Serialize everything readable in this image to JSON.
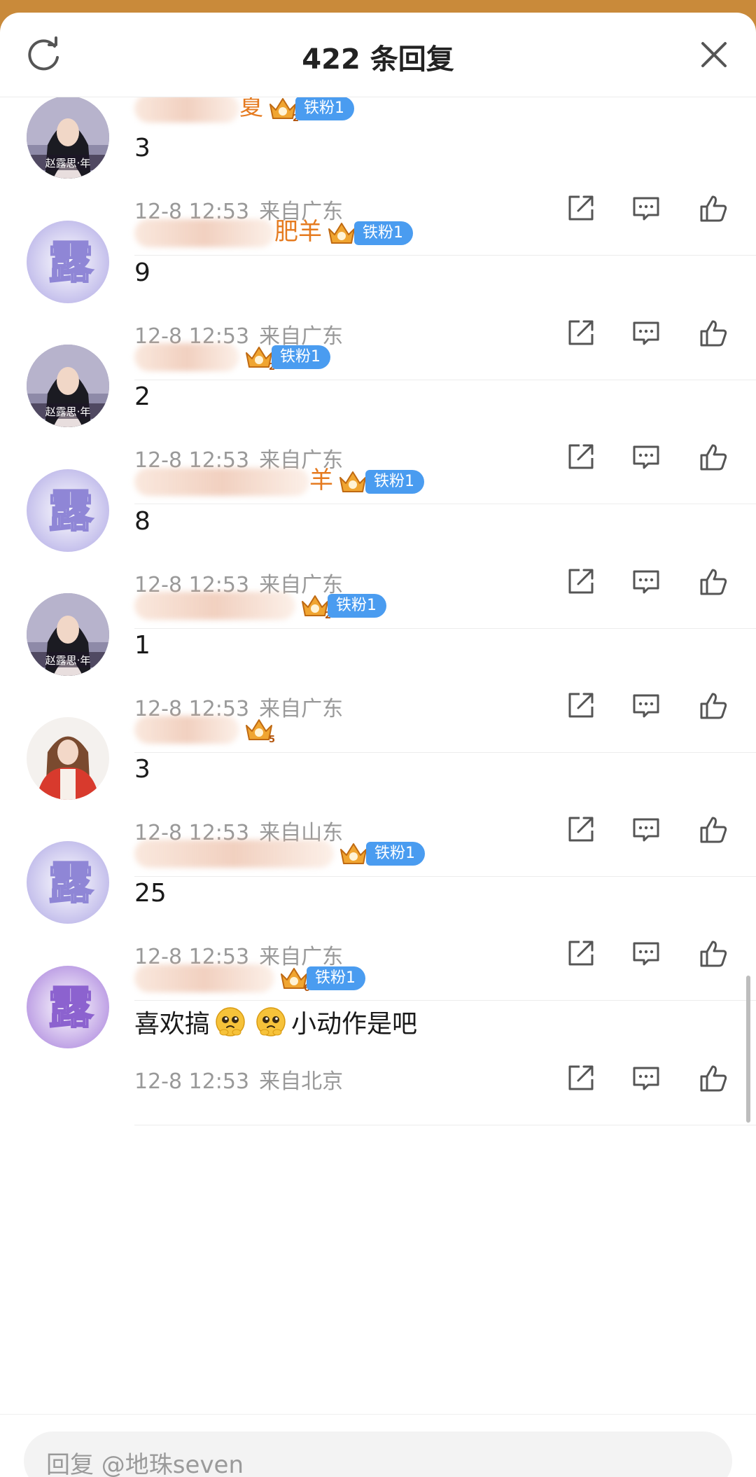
{
  "header": {
    "title": "422 条回复",
    "refresh_icon": "refresh-icon",
    "close_icon": "close-icon"
  },
  "comments": [
    {
      "name_visible": "夏",
      "name_blurred": true,
      "crown_level": "2",
      "fan_badge": "铁粉1",
      "content": "3",
      "date": "12-8 12:53",
      "location": "来自广东",
      "avatar": "portrait-girl"
    },
    {
      "name_visible": "肥羊",
      "name_blurred": true,
      "crown_level": "",
      "fan_badge": "铁粉1",
      "content": "9",
      "date": "12-8 12:53",
      "location": "来自广东",
      "avatar": "lu-character"
    },
    {
      "name_visible": "",
      "name_blurred": true,
      "crown_level": "2",
      "fan_badge": "铁粉1",
      "content": "2",
      "date": "12-8 12:53",
      "location": "来自广东",
      "avatar": "portrait-girl"
    },
    {
      "name_visible": "羊",
      "name_blurred": true,
      "crown_level": "",
      "fan_badge": "铁粉1",
      "content": "8",
      "date": "12-8 12:53",
      "location": "来自广东",
      "avatar": "lu-character"
    },
    {
      "name_visible": "",
      "name_blurred": true,
      "crown_level": "2",
      "fan_badge": "铁粉1",
      "content": "1",
      "date": "12-8 12:53",
      "location": "来自广东",
      "avatar": "portrait-girl"
    },
    {
      "name_visible": "",
      "name_blurred": true,
      "crown_level": "5",
      "fan_badge": "",
      "content": "3",
      "date": "12-8 12:53",
      "location": "来自山东",
      "avatar": "girl-red-jacket"
    },
    {
      "name_visible": "",
      "name_blurred": true,
      "crown_level": "",
      "fan_badge": "铁粉1",
      "content": "25",
      "date": "12-8 12:53",
      "location": "来自广东",
      "avatar": "lu-character"
    },
    {
      "name_visible": "",
      "name_blurred": true,
      "crown_level": "6",
      "fan_badge": "铁粉1",
      "content_before": "喜欢搞",
      "content_after": "小动作是吧",
      "emoji_count": 2,
      "emoji": "pleading-face-icon",
      "date": "12-8 12:53",
      "location": "来自北京",
      "avatar": "lu-character-purple"
    }
  ],
  "actions": {
    "share_icon": "share-icon",
    "comment_icon": "comment-icon",
    "like_icon": "like-icon"
  },
  "avatar_texts": {
    "portrait_caption": "赵露思·年",
    "lu_glyph": "露"
  },
  "colors": {
    "username": "#e57a1f",
    "badge": "#4a9cf0",
    "meta": "#999999",
    "lu_avatar": "#b9b3e8"
  },
  "footer": {
    "reply_placeholder": "回复 @地珠seven"
  }
}
